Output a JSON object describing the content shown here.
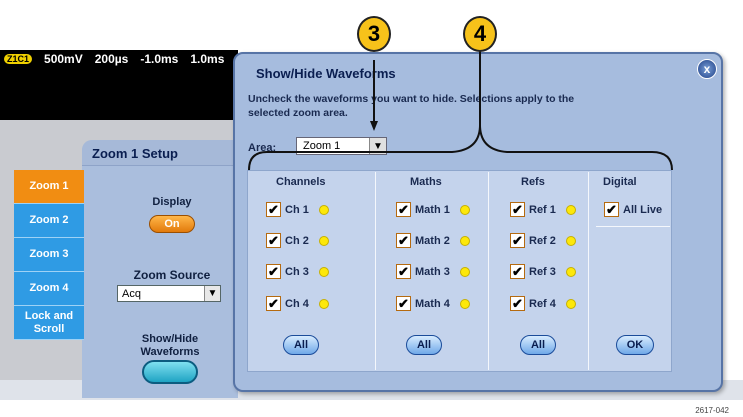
{
  "statusbar": {
    "badge": "Z1C1",
    "volts": "500mV",
    "time1": "200µs",
    "time2": "-1.0ms",
    "time3": "1.0ms"
  },
  "tabs": [
    {
      "label": "Zoom 1",
      "active": true
    },
    {
      "label": "Zoom 2",
      "active": false
    },
    {
      "label": "Zoom 3",
      "active": false
    },
    {
      "label": "Zoom 4",
      "active": false
    },
    {
      "label": "Lock and Scroll",
      "active": false
    }
  ],
  "setup": {
    "title": "Zoom 1 Setup",
    "display_label": "Display",
    "display_value": "On",
    "source_label": "Zoom Source",
    "source_value": "Acq",
    "showhide_label_line1": "Show/Hide",
    "showhide_label_line2": "Waveforms"
  },
  "dialog": {
    "title": "Show/Hide Waveforms",
    "instructions": "Uncheck the waveforms you want to hide. Selections apply to the selected zoom area.",
    "area_label": "Area:",
    "area_value": "Zoom 1",
    "close": "x",
    "columns": {
      "channels": {
        "head": "Channels",
        "items": [
          "Ch 1",
          "Ch 2",
          "Ch 3",
          "Ch 4"
        ],
        "button": "All"
      },
      "maths": {
        "head": "Maths",
        "items": [
          "Math 1",
          "Math 2",
          "Math 3",
          "Math 4"
        ],
        "button": "All"
      },
      "refs": {
        "head": "Refs",
        "items": [
          "Ref 1",
          "Ref 2",
          "Ref 3",
          "Ref 4"
        ],
        "button": "All"
      },
      "digital": {
        "head": "Digital",
        "items": [
          "All Live"
        ],
        "button": "OK"
      }
    }
  },
  "callouts": [
    "3",
    "4"
  ],
  "footer": "2617-042",
  "colors": {
    "accent_orange": "#f18d12",
    "tab_blue": "#2f9be4",
    "dialog_blue": "#a6bcde",
    "dot_yellow": "#fde80a"
  }
}
